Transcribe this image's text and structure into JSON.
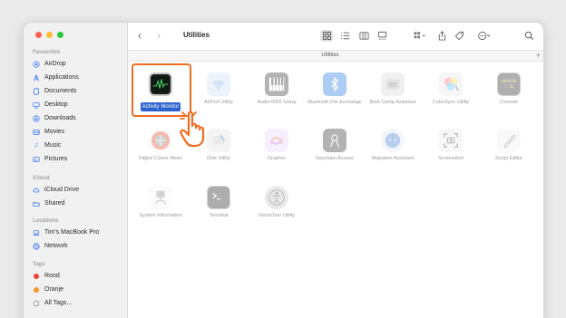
{
  "window": {
    "title": "Utilities",
    "path_label": "Utilities",
    "path_add": "+"
  },
  "sidebar": {
    "favourites_title": "Favourites",
    "favourites": [
      {
        "label": "AirDrop",
        "icon": "airdrop-icon"
      },
      {
        "label": "Applications",
        "icon": "applications-icon"
      },
      {
        "label": "Documents",
        "icon": "documents-icon"
      },
      {
        "label": "Desktop",
        "icon": "desktop-icon"
      },
      {
        "label": "Downloads",
        "icon": "downloads-icon"
      },
      {
        "label": "Movies",
        "icon": "movies-icon"
      },
      {
        "label": "Music",
        "icon": "music-icon"
      },
      {
        "label": "Pictures",
        "icon": "pictures-icon"
      }
    ],
    "icloud_title": "iCloud",
    "icloud": [
      {
        "label": "iCloud Drive",
        "icon": "cloud-icon"
      },
      {
        "label": "Shared",
        "icon": "shared-folder-icon"
      }
    ],
    "locations_title": "Locations",
    "locations": [
      {
        "label": "Tim's MacBook Pro",
        "icon": "laptop-icon"
      },
      {
        "label": "Network",
        "icon": "network-icon"
      }
    ],
    "tags_title": "Tags",
    "tags": [
      {
        "label": "Rood",
        "color": "#f0453a"
      },
      {
        "label": "Oranje",
        "color": "#f49a2a"
      },
      {
        "label": "All Tags...",
        "icon": "tags-icon"
      }
    ]
  },
  "toolbar": {
    "back": "‹",
    "forward": "›"
  },
  "apps": [
    {
      "label": "Activity Monitor",
      "icon": "activity-monitor-icon",
      "selected": true
    },
    {
      "label": "AirPort Utility",
      "icon": "airport-utility-icon"
    },
    {
      "label": "Audio MIDI Setup",
      "icon": "audio-midi-icon"
    },
    {
      "label": "Bluetooth File Exchange",
      "icon": "bluetooth-icon"
    },
    {
      "label": "Boot Camp Assistant",
      "icon": "boot-camp-icon"
    },
    {
      "label": "ColorSync Utility",
      "icon": "colorsync-icon"
    },
    {
      "label": "Console",
      "icon": "console-icon",
      "icon_text": "WARNIN\n7:36"
    },
    {
      "label": "Digital Colour Meter",
      "icon": "colour-meter-icon"
    },
    {
      "label": "Disk Utility",
      "icon": "disk-utility-icon"
    },
    {
      "label": "Grapher",
      "icon": "grapher-icon"
    },
    {
      "label": "Keychain Access",
      "icon": "keychain-icon"
    },
    {
      "label": "Migration Assistant",
      "icon": "migration-icon"
    },
    {
      "label": "Screenshot",
      "icon": "screenshot-icon"
    },
    {
      "label": "Script Editor",
      "icon": "script-editor-icon"
    },
    {
      "label": "System Information",
      "icon": "system-information-icon"
    },
    {
      "label": "Terminal",
      "icon": "terminal-icon"
    },
    {
      "label": "VoiceOver Utility",
      "icon": "voiceover-icon"
    }
  ],
  "colors": {
    "selection": "#2b62cf",
    "highlight": "#f26b21"
  }
}
